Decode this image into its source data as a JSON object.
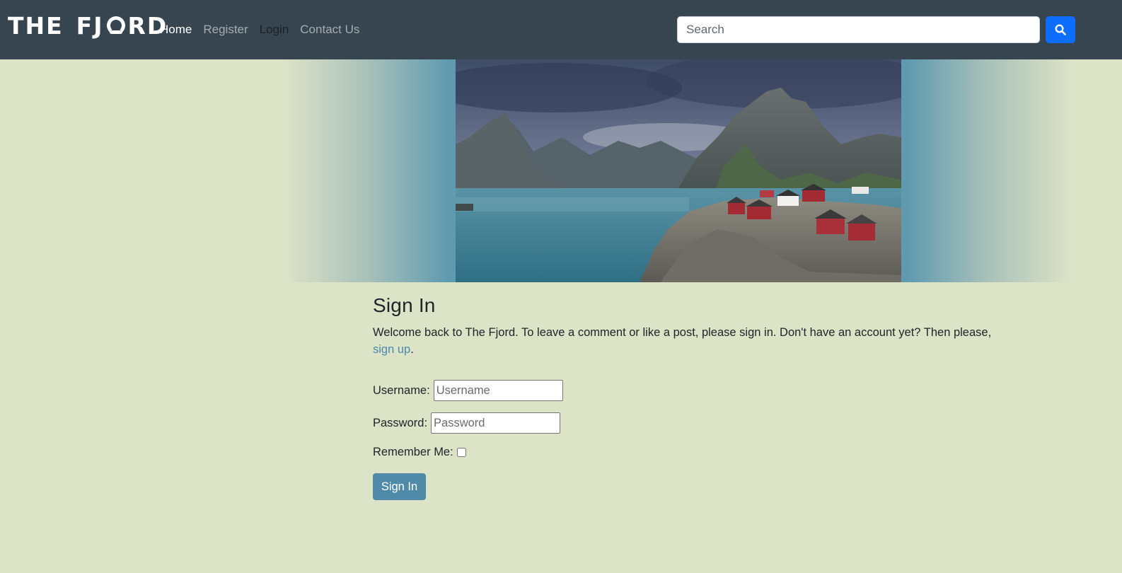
{
  "brand": {
    "left": "THE",
    "right_a": "FJ",
    "right_b": "RD",
    "full": "THE FJORD"
  },
  "nav": {
    "home": "Home",
    "register": "Register",
    "login": "Login",
    "contact": "Contact Us"
  },
  "search": {
    "placeholder": "Search",
    "button_icon": "search-icon"
  },
  "hero": {
    "alt": "Fjord landscape with red cabins"
  },
  "signin": {
    "title": "Sign In",
    "intro_text": "Welcome back to The Fjord. To leave a comment or like a post, please sign in. Don't have an account yet? Then please, ",
    "signup_link": "sign up",
    "intro_end": ".",
    "username_label": "Username:",
    "username_placeholder": "Username",
    "password_label": "Password:",
    "password_placeholder": "Password",
    "remember_label": "Remember Me:",
    "submit_label": "Sign In"
  },
  "colors": {
    "navbar": "#36454f",
    "background": "#dde3c7",
    "search_button": "#0d6efd",
    "signin_button": "#4f8ba8",
    "link": "#4a8aab"
  }
}
